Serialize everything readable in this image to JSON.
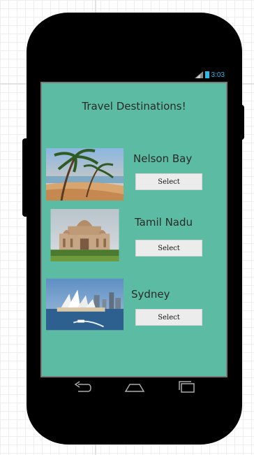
{
  "status_bar": {
    "time": "3:03",
    "colors": {
      "accent": "#33b5e5"
    }
  },
  "app": {
    "title": "Travel Destinations!",
    "background_color": "#5bbba3",
    "destinations": [
      {
        "name": "Nelson Bay",
        "button_label": "Select",
        "image": "beach-palm-trees-photo"
      },
      {
        "name": "Tamil Nadu",
        "button_label": "Select",
        "image": "temple-photo"
      },
      {
        "name": "Sydney",
        "button_label": "Select",
        "image": "sydney-opera-house-photo"
      }
    ]
  },
  "nav_bar": {
    "icons": [
      "back-icon",
      "home-icon",
      "recents-icon"
    ]
  }
}
